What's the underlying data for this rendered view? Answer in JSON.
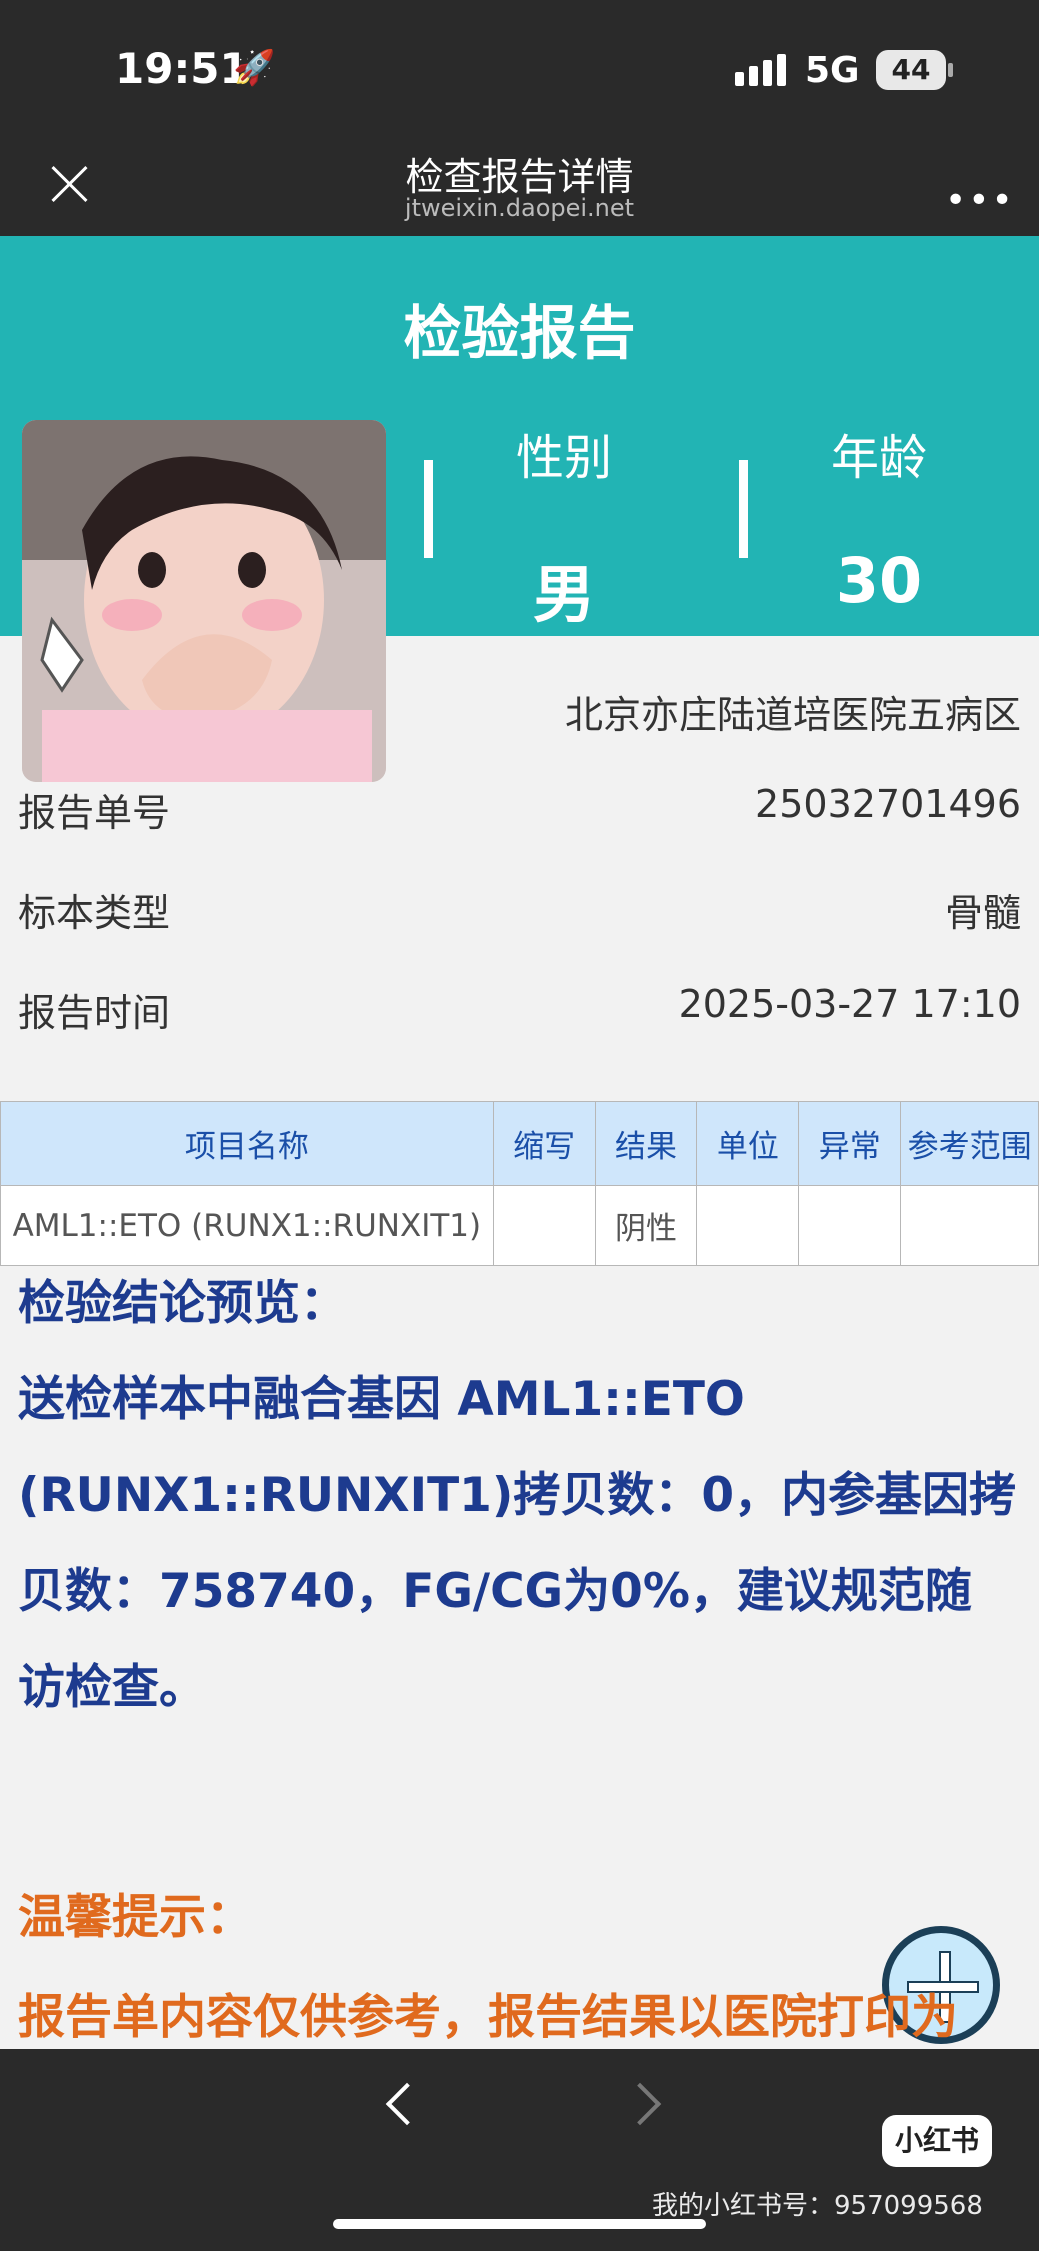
{
  "status_bar": {
    "time": "19:51",
    "network": "5G",
    "battery": "44"
  },
  "nav": {
    "title": "检查报告详情",
    "subtitle": "jtweixin.daopei.net"
  },
  "report": {
    "heading": "检验报告",
    "gender_label": "性别",
    "gender_value": "男",
    "age_label": "年龄",
    "age_value": "30",
    "hospital_value": "北京亦庄陆道培医院五病区",
    "report_no_label": "报告单号",
    "report_no_value": "25032701496",
    "specimen_label": "标本类型",
    "specimen_value": "骨髓",
    "time_label": "报告时间",
    "time_value": "2025-03-27 17:10"
  },
  "table": {
    "headers": [
      "项目名称",
      "缩写",
      "结果",
      "单位",
      "异常",
      "参考范围"
    ],
    "rows": [
      [
        "AML1::ETO (RUNX1::RUNXIT1)",
        "",
        "阴性",
        "",
        "",
        ""
      ]
    ]
  },
  "conclusion": {
    "title": "检验结论预览：",
    "text": "送检样本中融合基因 AML1::ETO (RUNX1::RUNXIT1)拷贝数：0，内参基因拷贝数：758740，FG/CG为0%，建议规范随访检查。"
  },
  "tip": {
    "title": "温馨提示：",
    "text": "报告单内容仅供参考，报告结果以医院打印为准，最终解释权归陆道培医疗集"
  },
  "bottom": {
    "badge": "小红书",
    "watermark": "我的小红书号：957099568"
  },
  "icons": [
    "rocket-icon",
    "close-icon",
    "more-icon",
    "plus-icon",
    "back-arrow-icon",
    "forward-arrow-icon"
  ]
}
